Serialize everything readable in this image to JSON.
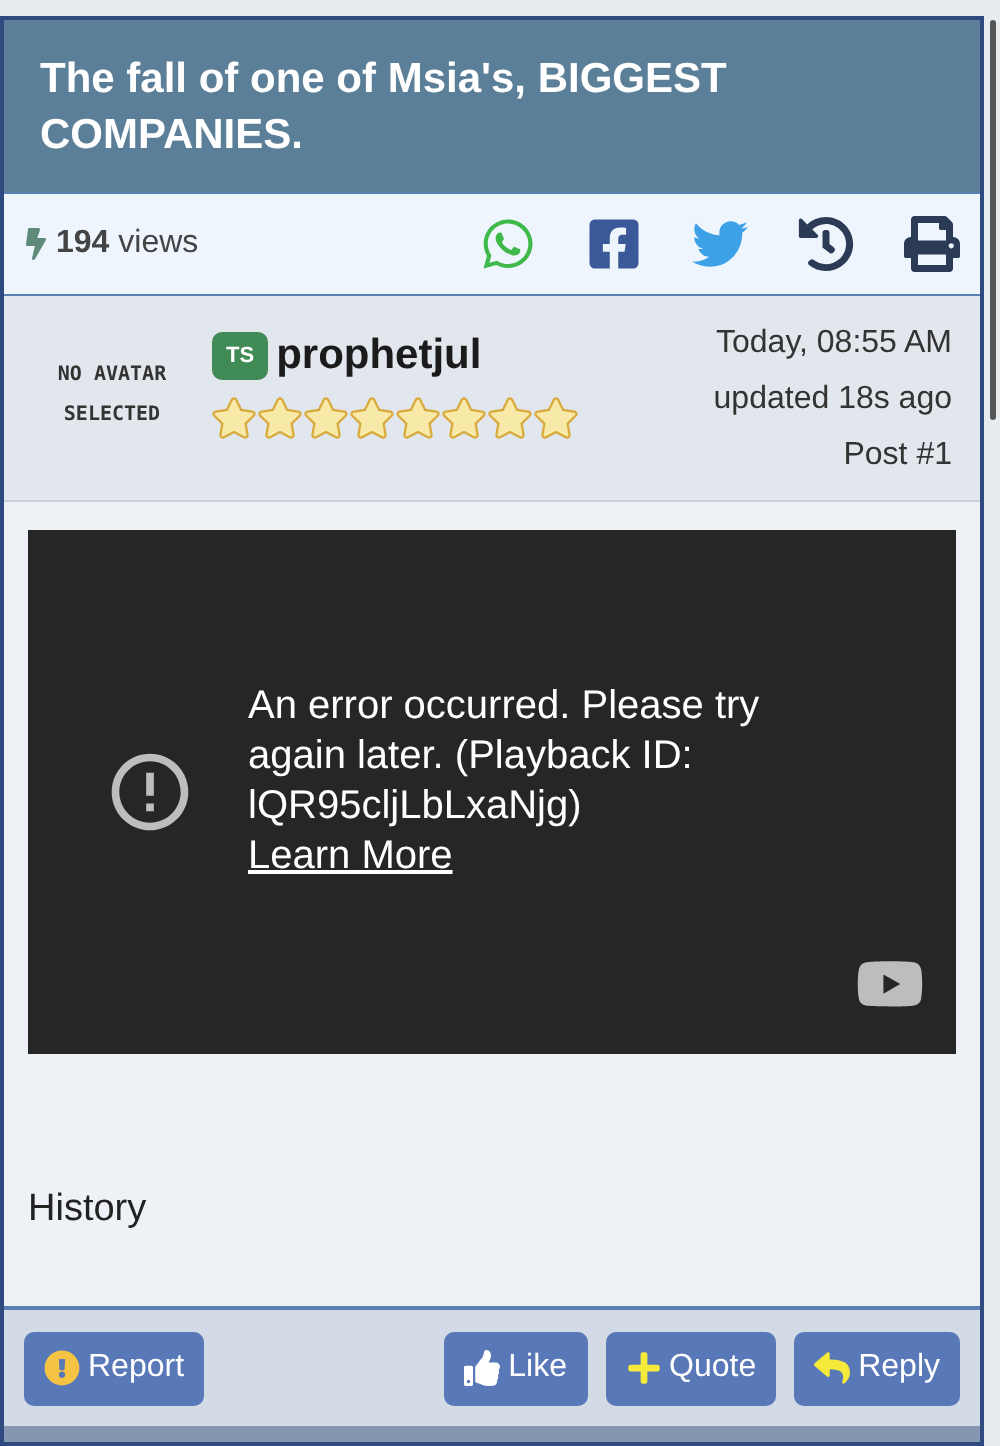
{
  "thread": {
    "title": "The fall of one of Msia's, BIGGEST COMPANIES."
  },
  "stats": {
    "views": "**194** views"
  },
  "share_icons": [
    {
      "kind": "whatsapp"
    },
    {
      "kind": "facebook"
    },
    {
      "kind": "twitter"
    },
    {
      "kind": "history"
    },
    {
      "kind": "print"
    }
  ],
  "post": {
    "avatar_text": "NO AVATAR SELECTED",
    "badge": "TS",
    "username": "prophetjul",
    "stars": 8,
    "date": "Today, 08:55 AM",
    "updated": "updated 18s ago",
    "number": "Post #1",
    "video_error": {
      "message": "An error occurred. Please try again later. (Playback ID: lQR95cljLbLxaNjg)",
      "link": "Learn More"
    },
    "body": "History"
  },
  "actions": [
    {
      "kind": "report",
      "label": "Report"
    },
    {
      "kind": "like",
      "label": "Like"
    },
    {
      "kind": "quote",
      "label": "Quote"
    },
    {
      "kind": "reply",
      "label": "Reply"
    }
  ]
}
